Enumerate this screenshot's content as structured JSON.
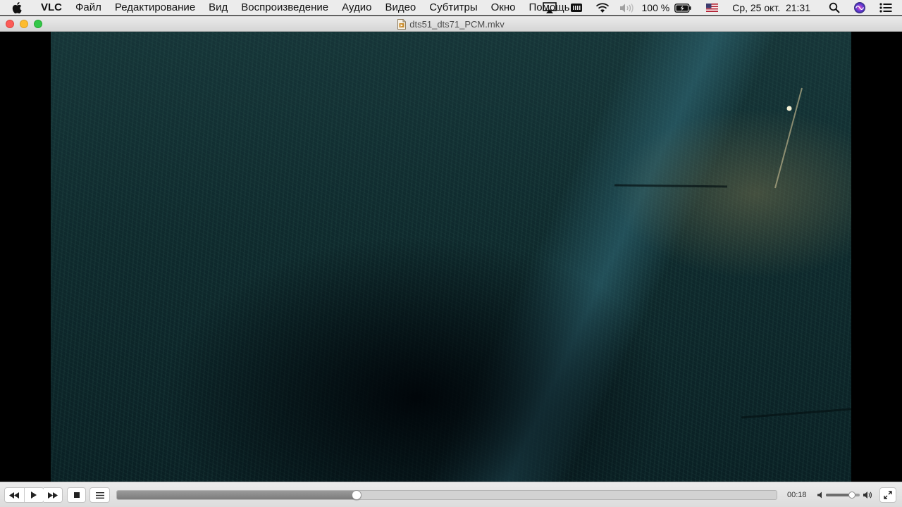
{
  "menubar": {
    "app_name": "VLC",
    "items": [
      "Файл",
      "Редактирование",
      "Вид",
      "Воспроизведение",
      "Аудио",
      "Видео",
      "Субтитры",
      "Окно",
      "Помощь"
    ],
    "battery_text": "100 %",
    "datetime": "Ср, 25 окт.  21:31",
    "icons": [
      "apple-icon",
      "airplay-icon",
      "memory-icon",
      "wifi-icon",
      "volume-icon",
      "battery-icon",
      "flag-us-icon",
      "search-icon",
      "siri-icon",
      "notification-center-icon"
    ]
  },
  "window": {
    "title": "dts51_dts71_PCM.mkv"
  },
  "controls": {
    "time": "00:18",
    "progress": 0.364,
    "volume": 0.78,
    "icons": [
      "rewind-icon",
      "play-icon",
      "fast-forward-icon",
      "stop-icon",
      "playlist-icon",
      "volume-low-icon",
      "volume-high-icon",
      "fullscreen-icon"
    ]
  },
  "colors": {
    "close": "#fc5b57",
    "minimize": "#fdbc2e",
    "zoom": "#33c748"
  }
}
